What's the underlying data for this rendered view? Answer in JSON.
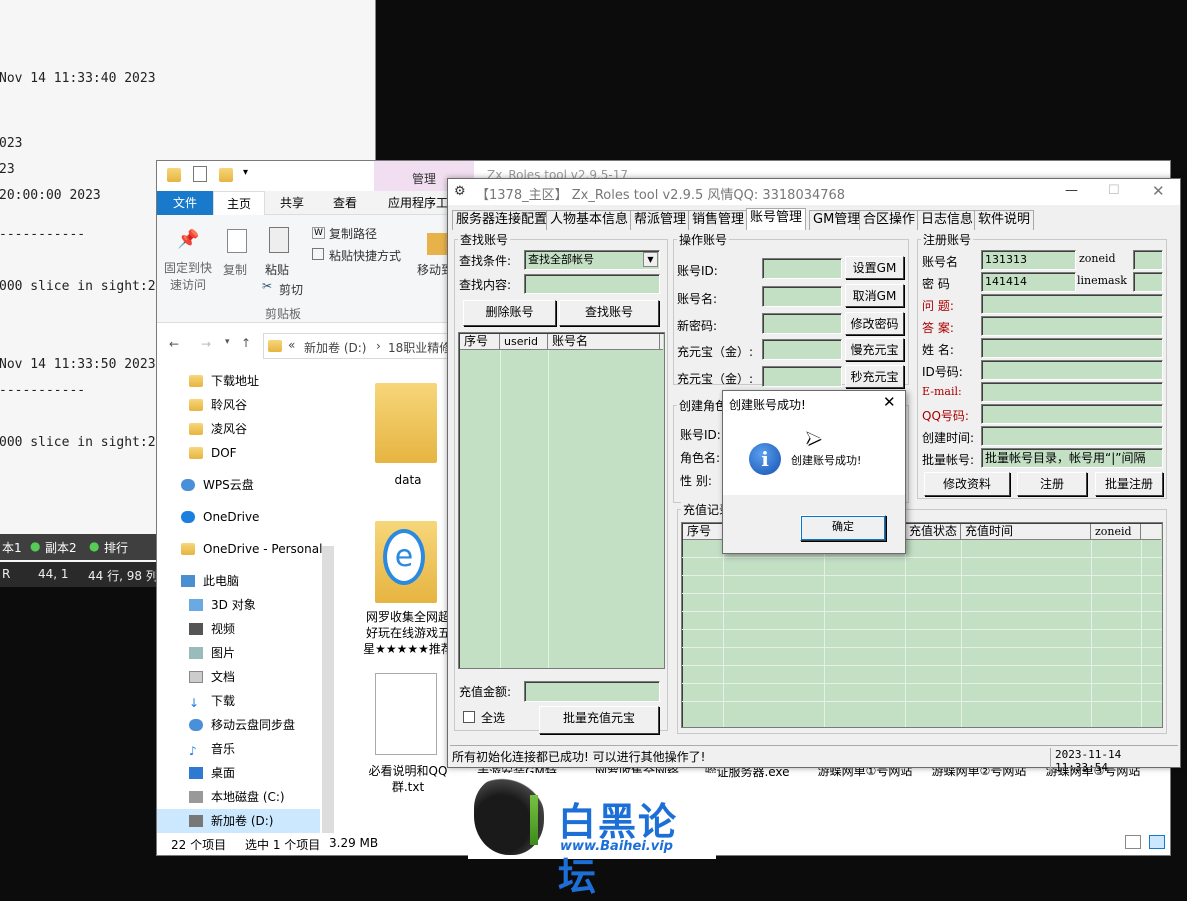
{
  "terminal": {
    "lines": [
      "Nov 14 11:33:40 2023",
      "023",
      "23",
      "20:00:00 2023",
      "-----------",
      "000 slice in sight:2",
      "Nov 14 11:33:50 2023",
      "-----------",
      "000 slice in sight:2"
    ],
    "status": {
      "tab1": "本1",
      "tab2": "副本2",
      "tab3": "排行"
    },
    "bar": {
      "left": "R",
      "pos": "44,  1",
      "lines": "44 行, 98 列"
    }
  },
  "explorer": {
    "title": "Zx_Roles tool v2.9.5-17",
    "context_tab": "管理",
    "tabs": [
      "文件",
      "主页",
      "共享",
      "查看",
      "应用程序工具"
    ],
    "ribbon": {
      "pin": "固定到快速访问",
      "copy": "复制",
      "paste": "粘贴",
      "copy_path": "复制路径",
      "paste_shortcut": "粘贴快捷方式",
      "cut": "剪切",
      "clipboard": "剪贴板",
      "move_to": "移动到"
    },
    "address": {
      "drive": "新加卷 (D:)",
      "folder": "18职业精修",
      "prefix": "«"
    },
    "nav": [
      "下载地址",
      "聆风谷",
      "凌风谷",
      "DOF",
      "WPS云盘",
      "OneDrive",
      "OneDrive - Personal",
      "此电脑",
      "3D 对象",
      "视频",
      "图片",
      "文档",
      "下载",
      "移动云盘同步盘",
      "音乐",
      "桌面",
      "本地磁盘 (C:)",
      "新加卷 (D:)"
    ],
    "files": {
      "f1": "data",
      "f2": "网罗收集全网超好玩在线游戏五星★★★★★推荐",
      "f3": "必看说明和QQ群.txt",
      "f4": "手游安装GM特",
      "f5": "网罗收集全网络",
      "f6": "验证服务器.exe",
      "f7": "游蝶网单①号网站",
      "f8": "游蝶网单②号网站",
      "f9": "游蝶网单③号网站"
    },
    "status": {
      "count": "22 个项目",
      "selected": "选中 1 个项目",
      "size": "3.29 MB"
    }
  },
  "app": {
    "title": "【1378_主区】 Zx_Roles tool v2.9.5 风情QQ: 3318034768",
    "tabs": [
      "服务器连接配置",
      "人物基本信息",
      "帮派管理",
      "销售管理",
      "账号管理",
      "GM管理",
      "合区操作",
      "日志信息",
      "软件说明"
    ],
    "selected_tab": "账号管理",
    "search": {
      "group": "查找账号",
      "cond_label": "查找条件:",
      "cond_value": "查找全部帐号",
      "content_label": "查找内容:",
      "delete_btn": "删除账号",
      "find_btn": "查找账号",
      "cols": [
        "序号",
        "userid",
        "账号名"
      ],
      "recharge_label": "充值金额:",
      "select_all": "全选",
      "batch_btn": "批量充值元宝"
    },
    "ops": {
      "group": "操作账号",
      "id_label": "账号ID:",
      "name_label": "账号名:",
      "pwd_label": "新密码:",
      "yb1_label": "充元宝（金）:",
      "yb2_label": "充元宝（金）:",
      "set_gm": "设置GM",
      "cancel_gm": "取消GM",
      "change_pwd": "修改密码",
      "slow_yb": "慢充元宝",
      "fast_yb": "秒充元宝"
    },
    "role": {
      "group": "创建角色",
      "id_label": "账号ID:",
      "name_label": "角色名:",
      "gender_label": "性  别:"
    },
    "reg": {
      "group": "注册账号",
      "acct_label": "账号名",
      "acct_value": "131313",
      "pwd_label": "密  码",
      "pwd_value": "141414",
      "zoneid": "zoneid",
      "linemask": "linemask",
      "question": "问  题:",
      "answer": "答  案:",
      "realname": "姓  名:",
      "idcard": "ID号码:",
      "email": "E-mail:",
      "qq": "QQ号码:",
      "created": "创建时间:",
      "batch_label": "批量帐号:",
      "batch_value": "批量帐号目录，帐号用“|”间隔",
      "edit_btn": "修改资料",
      "reg_btn": "注册",
      "batch_btn": "批量注册"
    },
    "recharge": {
      "group": "充值记录",
      "cols": [
        "序号",
        "充值状态",
        "充值时间",
        "zoneid"
      ]
    },
    "status": "所有初始化连接都已成功! 可以进行其他操作了!",
    "datetime": "2023-11-14 11:33:54"
  },
  "dialog": {
    "title": "创建账号成功!",
    "message": "创建账号成功!",
    "ok": "确定",
    "info_glyph": "i"
  },
  "logo": {
    "text": "白黑论坛",
    "url": "www.Baihei.vip"
  },
  "colors": {
    "grid": "#c3dfc4",
    "accent": "#0063b1",
    "logo_blue": "#1d6fd8"
  }
}
